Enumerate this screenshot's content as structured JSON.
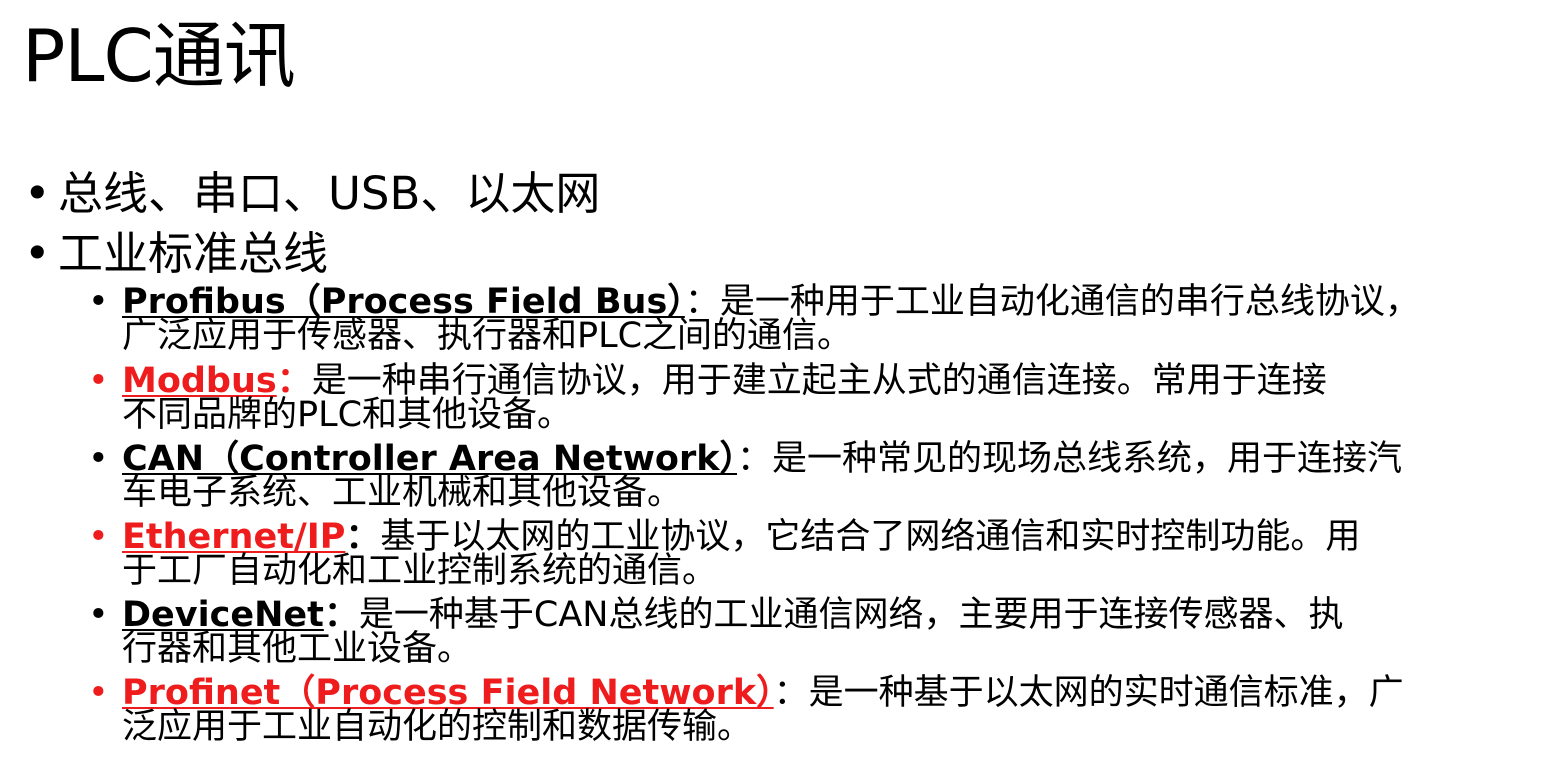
{
  "slide": {
    "title": "PLC通讯",
    "bullets": [
      {
        "text": "总线、串口、USB、以太网"
      },
      {
        "text": "工业标准总线"
      }
    ],
    "items": [
      {
        "term": "Profibus（Process Field Bus）",
        "sep": "：",
        "line1": "是一种用于工业自动化通信的串行总线协议，",
        "line2": "广泛应用于传感器、执行器和PLC之间的通信。",
        "highlight": false
      },
      {
        "term": "Modbus",
        "sep": "：",
        "line1": "是一种串行通信协议，用于建立起主从式的通信连接。常用于连接",
        "line2": "不同品牌的PLC和其他设备。",
        "highlight": true
      },
      {
        "term": "CAN（Controller Area Network）",
        "sep": "：",
        "line1": "是一种常见的现场总线系统，用于连接汽",
        "line2": "车电子系统、工业机械和其他设备。",
        "highlight": false
      },
      {
        "term": "Ethernet/IP",
        "sep": "：",
        "line1": "基于以太网的工业协议，它结合了网络通信和实时控制功能。用",
        "line2": "于工厂自动化和工业控制系统的通信。",
        "highlight": true
      },
      {
        "term": "DeviceNet",
        "sep": "：",
        "line1": "是一种基于CAN总线的工业通信网络，主要用于连接传感器、执",
        "line2": "行器和其他工业设备。",
        "highlight": false
      },
      {
        "term": "Profinet（Process Field Network）",
        "sep": "：",
        "line1": "是一种基于以太网的实时通信标准，广",
        "line2": "泛应用于工业自动化的控制和数据传输。",
        "highlight": true
      }
    ]
  },
  "colors": {
    "text": "#000000",
    "highlight": "#ee1c1c",
    "background": "#ffffff"
  }
}
